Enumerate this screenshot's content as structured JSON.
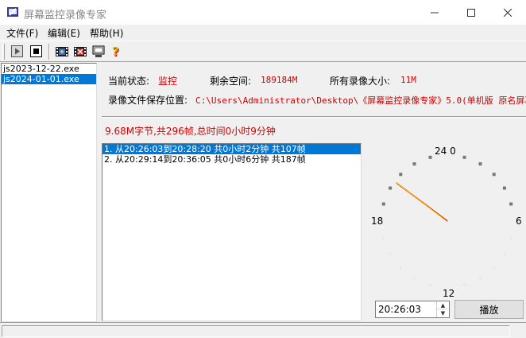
{
  "window": {
    "title": "屏幕监控录像专家"
  },
  "menu": {
    "file": "文件(F)",
    "edit": "编辑(E)",
    "help": "帮助(H)"
  },
  "toolbar": {
    "help_glyph": "?"
  },
  "files": [
    {
      "name": "js2023-12-22.exe",
      "selected": false
    },
    {
      "name": "js2024-01-01.exe",
      "selected": true
    }
  ],
  "info": {
    "status_label": "当前状态:",
    "status_value": "监控",
    "free_label": "剩余空间:",
    "free_value": "189184M",
    "total_label": "所有录像大小:",
    "total_value": "11M",
    "path_label": "录像文件保存位置:",
    "path_value": "C:\\Users\\Administrator\\Desktop\\《屏幕监控录像专家》5.0(单机版 原名屏幕",
    "summary": "9.68M字节,共296帧,总时间0小时9分钟"
  },
  "segments": [
    {
      "text": "1. 从20:26:03到20:28:20 共0小时2分钟 共107帧",
      "selected": true
    },
    {
      "text": "2. 从20:29:14到20:36:05 共0小时6分钟 共187帧",
      "selected": false
    }
  ],
  "clock": {
    "label_top": "24 0",
    "label_left": "18",
    "label_right": "6",
    "label_bottom": "12"
  },
  "player": {
    "time_value": "20:26:03",
    "play_label": "播放"
  },
  "colors": {
    "accent": "#0078d7",
    "status_red": "#d00000",
    "hand_red": "#c00000",
    "hand_yellow": "#ffd700"
  }
}
